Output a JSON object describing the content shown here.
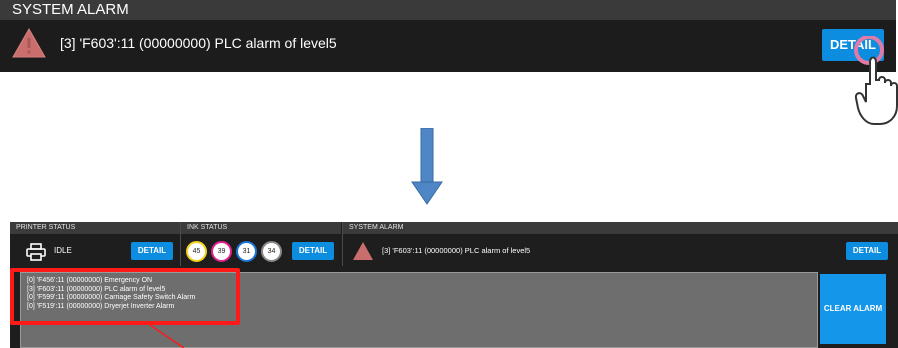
{
  "top_banner": {
    "title": "SYSTEM ALARM",
    "message": "[3] 'F603':11 (00000000) PLC alarm of level5",
    "detail_label": "DETAIL"
  },
  "status_bar": {
    "printer_status": {
      "label": "PRINTER STATUS",
      "state": "IDLE",
      "detail_label": "DETAIL"
    },
    "ink_status": {
      "label": "INK STATUS",
      "inks": [
        {
          "value": "45",
          "color": "#f2d21b"
        },
        {
          "value": "39",
          "color": "#e0208c"
        },
        {
          "value": "31",
          "color": "#1a74d8"
        },
        {
          "value": "34",
          "color": "#1a1a1a"
        }
      ],
      "detail_label": "DETAIL"
    },
    "system_alarm": {
      "label": "SYSTEM ALARM",
      "message": "[3] 'F603':11 (00000000) PLC alarm of level5",
      "detail_label": "DETAIL"
    }
  },
  "alarm_list": {
    "items": [
      "[0] 'F456':11 (00000000) Emergency ON",
      "[3] 'F603':11 (00000000) PLC alarm of level5",
      "[0] 'F599':11 (00000000) Carriage Safety Switch Alarm",
      "[0] 'F519':11 (00000000) Dryerjet Inverter Alarm"
    ],
    "clear_label": "CLEAR ALARM"
  },
  "colors": {
    "accent_blue": "#0d8de0",
    "warning_triangle": "#c96d6d",
    "highlight_red": "#ff1a1a",
    "arrow_blue": "#4f86c6"
  }
}
